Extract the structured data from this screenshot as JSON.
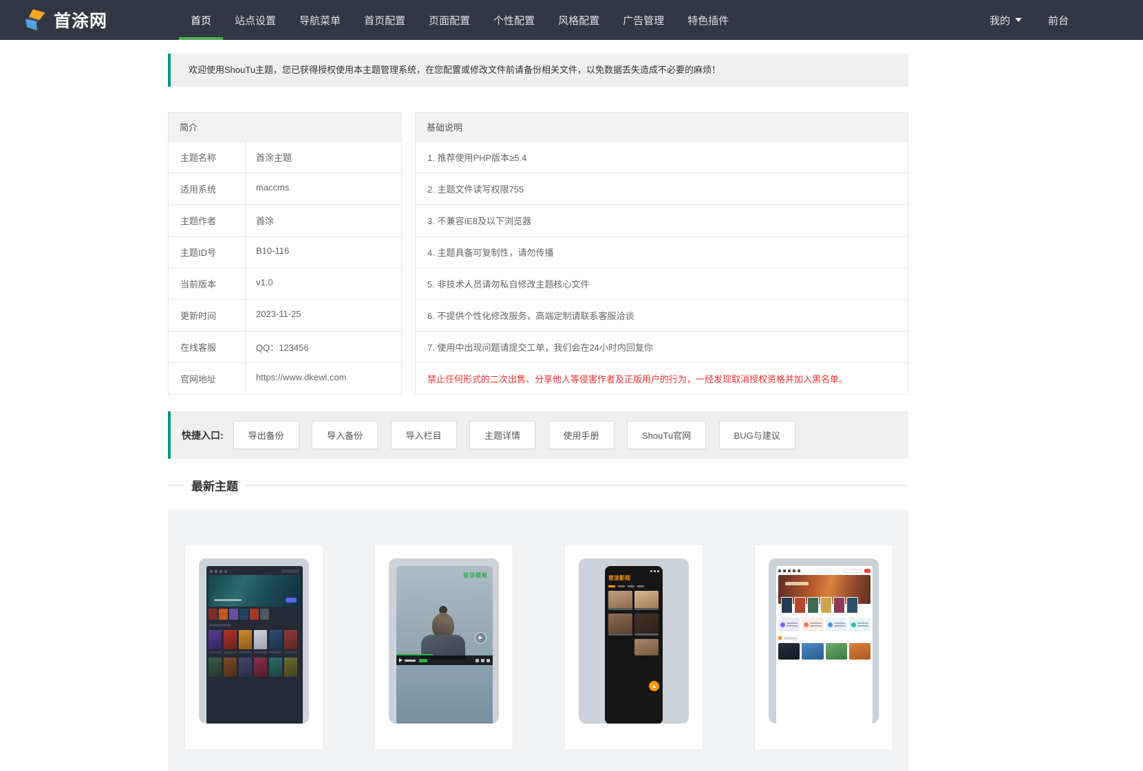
{
  "navbar": {
    "logo_text": "首涂网",
    "items": [
      {
        "label": "首页",
        "active": true
      },
      {
        "label": "站点设置",
        "active": false
      },
      {
        "label": "导航菜单",
        "active": false
      },
      {
        "label": "首页配置",
        "active": false
      },
      {
        "label": "页面配置",
        "active": false
      },
      {
        "label": "个性配置",
        "active": false
      },
      {
        "label": "风格配置",
        "active": false
      },
      {
        "label": "广告管理",
        "active": false
      },
      {
        "label": "特色插件",
        "active": false
      }
    ],
    "right": {
      "my_label": "我的",
      "front_label": "前台"
    }
  },
  "banner": {
    "text": "欢迎使用ShouTu主题，您已获得授权使用本主题管理系统，在您配置或修改文件前请备份相关文件，以免数据丢失造成不必要的麻烦！"
  },
  "intro_table": {
    "header": "简介",
    "rows": [
      {
        "label": "主题名称",
        "value": "首涂主题"
      },
      {
        "label": "适用系统",
        "value": "maccms"
      },
      {
        "label": "主题作者",
        "value": "首涂"
      },
      {
        "label": "主题ID号",
        "value": "B10-116"
      },
      {
        "label": "当前版本",
        "value": "v1.0"
      },
      {
        "label": "更新时间",
        "value": "2023-11-25"
      },
      {
        "label": "在线客服",
        "value": "QQ：123456"
      },
      {
        "label": "官网地址",
        "value": "https://www.dkewl.com"
      }
    ]
  },
  "notes_table": {
    "header": "基础说明",
    "rows": [
      "1. 推荐使用PHP版本≥5.4",
      "2. 主题文件读写权限755",
      "3. 不兼容IE8及以下浏览器",
      "4. 主题具备可复制性，请勿传播",
      "5. 非技术人员请勿私自修改主题核心文件",
      "6. 不提供个性化修改服务，高端定制请联系客服洽谈",
      "7. 使用中出现问题请提交工单，我们会在24小时内回复你"
    ],
    "warning": "禁止任何形式的二次出售、分享他人等侵害作者及正版用户的行为，一经发现取消授权资格并加入黑名单。"
  },
  "quick_entry": {
    "label": "快捷入口:",
    "buttons": [
      "导出备份",
      "导入备份",
      "导入栏目",
      "主题详情",
      "使用手册",
      "ShouTu官网",
      "BUG与建议"
    ]
  },
  "latest_section": {
    "title": "最新主题"
  },
  "theme_previews": {
    "badge_text": "首涂模板",
    "mobile_brand": "首涂影视"
  },
  "colors": {
    "navbar_bg": "#333744",
    "accent_green": "#4caf50",
    "teal_border": "#009688",
    "warning_red": "#f23030",
    "panel_gray": "#efefef"
  }
}
